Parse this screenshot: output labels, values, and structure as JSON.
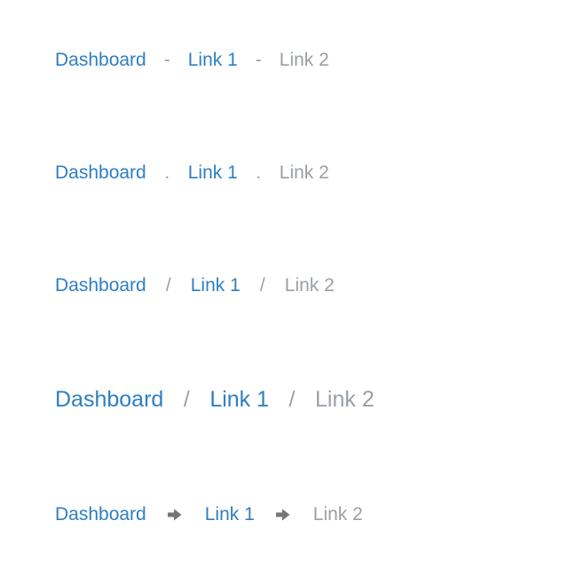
{
  "breadcrumbs": [
    {
      "style": "dash",
      "separator": "-",
      "items": [
        "Dashboard",
        "Link 1",
        "Link 2"
      ]
    },
    {
      "style": "dot",
      "separator": ".",
      "items": [
        "Dashboard",
        "Link 1",
        "Link 2"
      ]
    },
    {
      "style": "slash",
      "separator": "/",
      "items": [
        "Dashboard",
        "Link 1",
        "Link 2"
      ]
    },
    {
      "style": "slash-large",
      "separator": "/",
      "items": [
        "Dashboard",
        "Link 1",
        "Link 2"
      ]
    },
    {
      "style": "arrow",
      "separator_icon": "arrow-right-icon",
      "items": [
        "Dashboard",
        "Link 1",
        "Link 2"
      ]
    }
  ],
  "colors": {
    "link": "#2f7fc1",
    "current": "#9aa0a6",
    "separator": "#9aa0a6",
    "arrow": "#757575"
  }
}
